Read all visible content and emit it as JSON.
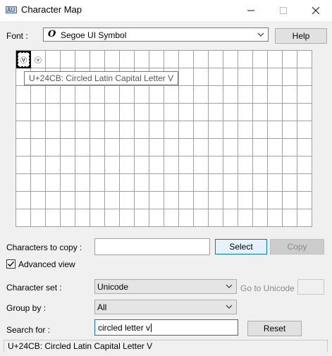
{
  "window": {
    "title": "Character Map",
    "controls": [
      "minimize",
      "maximize",
      "close"
    ]
  },
  "font": {
    "label": "Font :",
    "value": "Segoe UI Symbol",
    "glyph": "O",
    "help_label": "Help"
  },
  "grid": {
    "columns": 20,
    "rows": 10,
    "characters": [
      "Ⓥ",
      "ⓥ"
    ],
    "selected_index": 0,
    "tooltip": "U+24CB: Circled Latin Capital Letter V"
  },
  "copy": {
    "label": "Characters to copy :",
    "value": "",
    "select_label": "Select",
    "copy_label": "Copy"
  },
  "advanced": {
    "label": "Advanced view",
    "checked": true
  },
  "charset": {
    "label": "Character set :",
    "value": "Unicode",
    "goto_label": "Go to Unicode :",
    "goto_value": ""
  },
  "groupby": {
    "label": "Group by :",
    "value": "All"
  },
  "search": {
    "label": "Search for :",
    "value": "circled letter v",
    "reset_label": "Reset"
  },
  "status": {
    "text": "U+24CB: Circled Latin Capital Letter V"
  }
}
